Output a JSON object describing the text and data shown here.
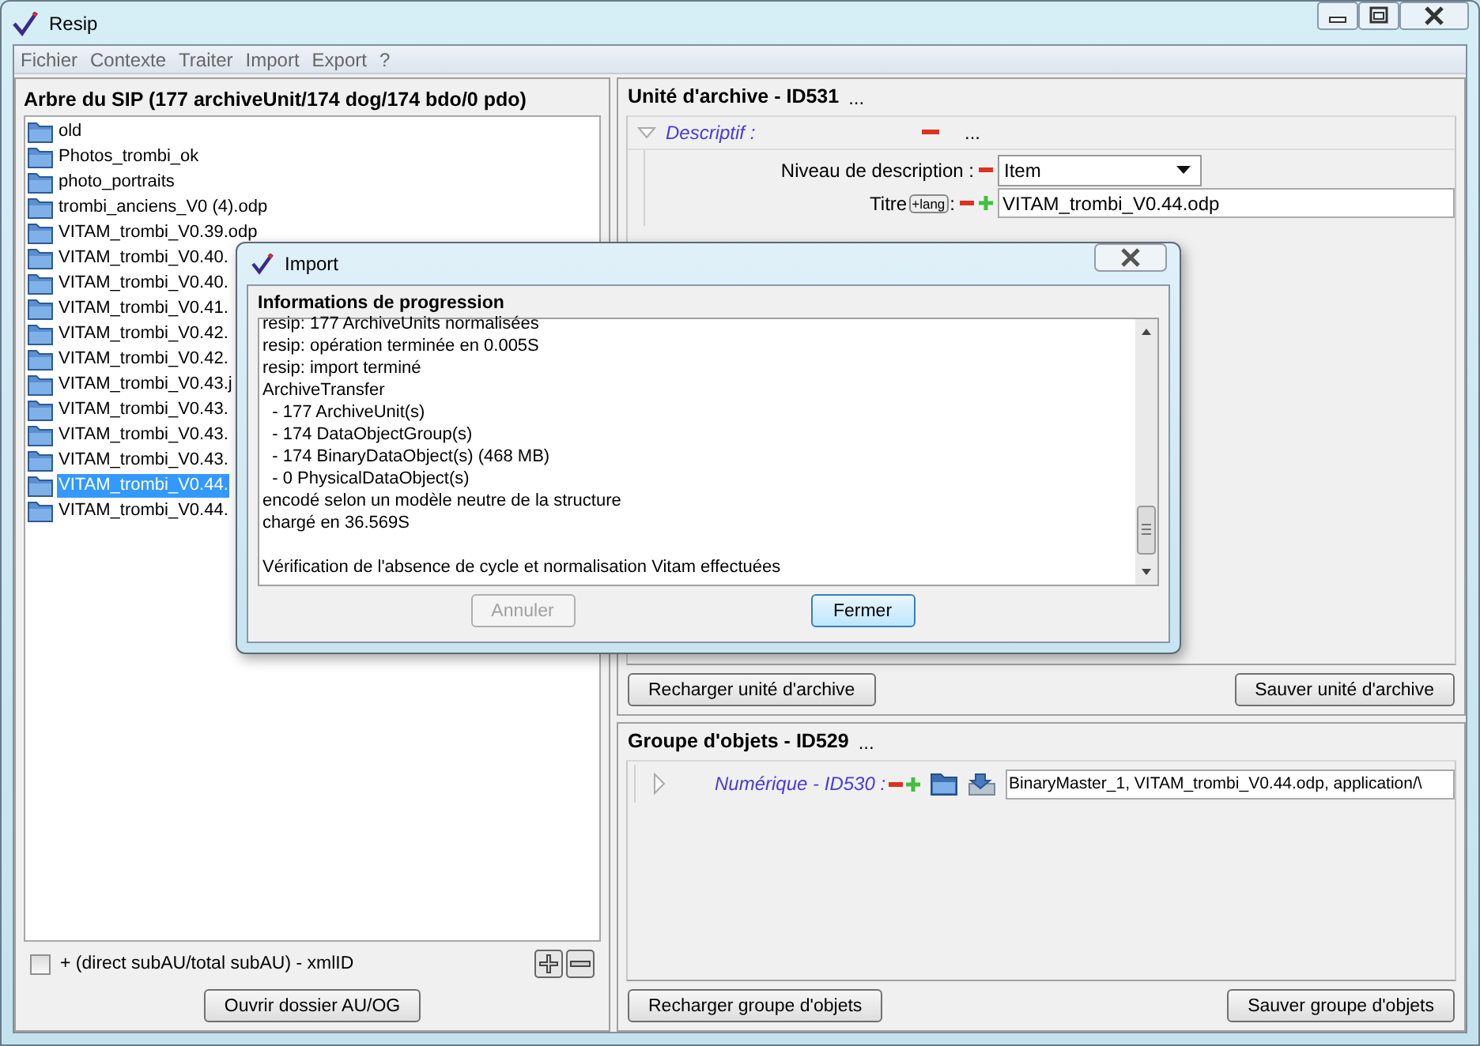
{
  "window": {
    "title": "Resip"
  },
  "menu": [
    "Fichier",
    "Contexte",
    "Traiter",
    "Import",
    "Export",
    "?"
  ],
  "sip_tree": {
    "title": "Arbre du SIP (177 archiveUnit/174 dog/174 bdo/0 pdo)",
    "items": [
      {
        "label": "old",
        "selected": false
      },
      {
        "label": "Photos_trombi_ok",
        "selected": false
      },
      {
        "label": "photo_portraits",
        "selected": false
      },
      {
        "label": "trombi_anciens_V0 (4).odp",
        "selected": false
      },
      {
        "label": "VITAM_trombi_V0.39.odp",
        "selected": false
      },
      {
        "label": "VITAM_trombi_V0.40.",
        "selected": false
      },
      {
        "label": "VITAM_trombi_V0.40.",
        "selected": false
      },
      {
        "label": "VITAM_trombi_V0.41.",
        "selected": false
      },
      {
        "label": "VITAM_trombi_V0.42.",
        "selected": false
      },
      {
        "label": "VITAM_trombi_V0.42.",
        "selected": false
      },
      {
        "label": "VITAM_trombi_V0.43.j",
        "selected": false
      },
      {
        "label": "VITAM_trombi_V0.43.",
        "selected": false
      },
      {
        "label": "VITAM_trombi_V0.43.",
        "selected": false
      },
      {
        "label": "VITAM_trombi_V0.43.",
        "selected": false
      },
      {
        "label": "VITAM_trombi_V0.44.",
        "selected": true
      },
      {
        "label": "VITAM_trombi_V0.44.",
        "selected": false
      }
    ],
    "option": {
      "label": "+ (direct subAU/total subAU) - xmlID",
      "checked": false
    },
    "open_button": "Ouvrir dossier AU/OG"
  },
  "archive_unit": {
    "title": "Unité d'archive - ID531",
    "more": "...",
    "section": {
      "label": "Descriptif :",
      "expanded": true,
      "more": "..."
    },
    "fields": [
      {
        "kind": "select",
        "label": "Niveau de description :",
        "value": "Item"
      },
      {
        "kind": "text",
        "label": "Titre",
        "lang_button": "+lang",
        "separator": ":",
        "value": "VITAM_trombi_V0.44.odp"
      }
    ],
    "buttons": [
      "Recharger unité d'archive",
      "Sauver unité d'archive"
    ]
  },
  "object_group": {
    "title": "Groupe d'objets - ID529",
    "more": "...",
    "item": {
      "label": "Numérique - ID530 :",
      "expanded": false,
      "value": "BinaryMaster_1, VITAM_trombi_V0.44.odp, application/\\"
    },
    "buttons": [
      "Recharger groupe d'objets",
      "Sauver groupe d'objets"
    ]
  },
  "dialog": {
    "title": "Import",
    "section_title": "Informations de progression",
    "log": "resip: 177 ArchiveUnits normalisées\nresip: opération terminée en 0.005S\nresip: import terminé\nArchiveTransfer\n  - 177 ArchiveUnit(s)\n  - 174 DataObjectGroup(s)\n  - 174 BinaryDataObject(s) (468 MB)\n  - 0 PhysicalDataObject(s)\nencodé selon un modèle neutre de la structure\nchargé en 36.569S\n\nVérification de l'absence de cycle et normalisation Vitam effectuées",
    "buttons": [
      {
        "label": "Annuler",
        "disabled": true,
        "default": false
      },
      {
        "label": "Fermer",
        "disabled": false,
        "default": true
      }
    ]
  }
}
